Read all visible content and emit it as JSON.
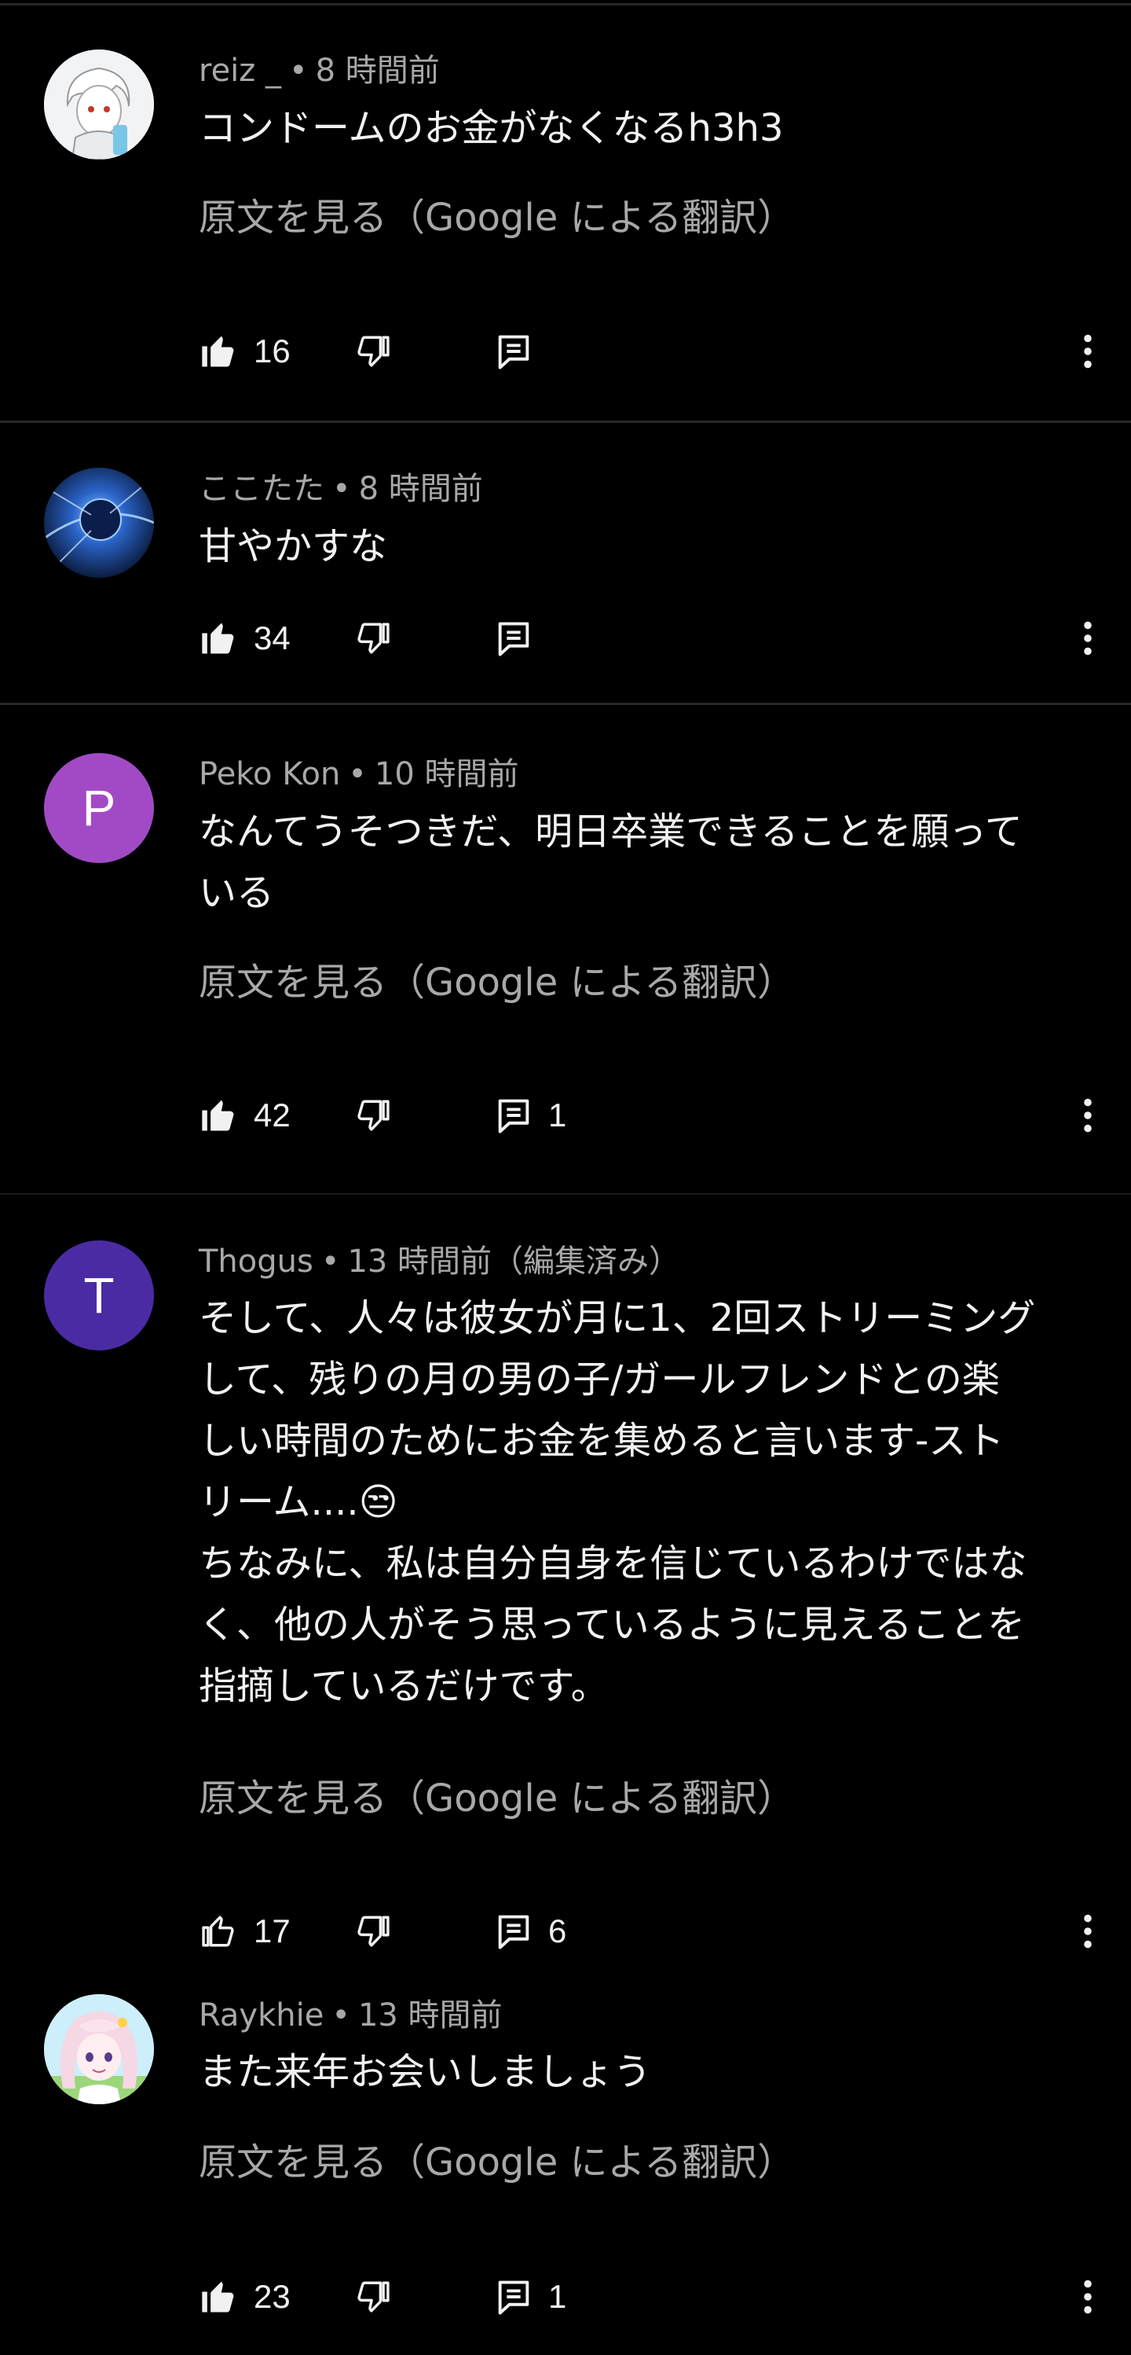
{
  "translate_label": "原文を見る（Google による翻訳）",
  "comments": [
    {
      "author": "reiz _",
      "time": "8 時間前",
      "text": "コンドームのお金がなくなるh3h3",
      "likes": "16",
      "replies": "",
      "avatar": "anime-portrait-white-hair"
    },
    {
      "author": "ここたた",
      "time": "8 時間前",
      "text": "甘やかすな",
      "likes": "34",
      "replies": "",
      "avatar": "blue-planet"
    },
    {
      "author": "Peko Kon",
      "time": "10 時間前",
      "text": "なんてうそつきだ、明日卒業できることを願って\nいる",
      "likes": "42",
      "replies": "1",
      "avatar_letter": "P",
      "avatar_color": "#a24ac6"
    },
    {
      "author": "Thogus",
      "time": "13 時間前（編集済み）",
      "text": "そして、人々は彼女が月に1、2回ストリーミング\nして、残りの月の男の子/ガールフレンドとの楽\nしい時間のためにお金を集めると言います-スト\nリーム....😒\nちなみに、私は自分自身を信じているわけではな\nく、他の人がそう思っているように見えることを\n指摘しているだけです。",
      "likes": "17",
      "replies": "6",
      "avatar_letter": "T",
      "avatar_color": "#4a2ba4"
    },
    {
      "author": "Raykhie",
      "time": "13 時間前",
      "text": "また来年お会いしましょう",
      "likes": "23",
      "replies": "1",
      "avatar": "anime-portrait-pink-hair"
    }
  ],
  "colors": {
    "background": "#000000",
    "divider": "#272727",
    "primary_text": "#f1f1f1",
    "secondary_text": "#a8a8a8"
  },
  "icons": [
    "thumb-up-icon",
    "thumb-down-icon",
    "reply-icon",
    "more-vert-icon"
  ]
}
